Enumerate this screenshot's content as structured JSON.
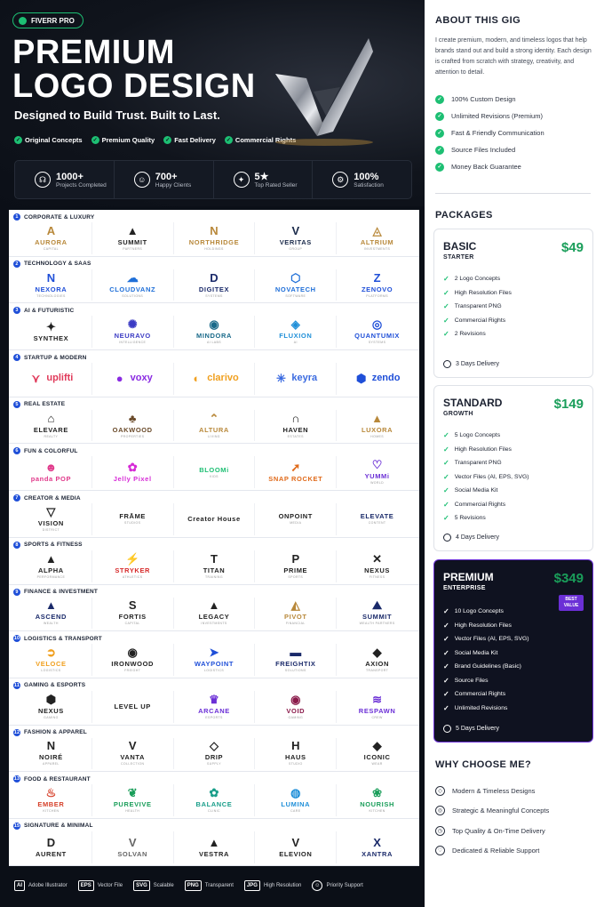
{
  "brand_colors": {
    "green": "#1dbf73",
    "purple": "#6b2fd6",
    "blue": "#1f4fd8"
  },
  "hero": {
    "badge": "FIVERR PRO",
    "title_line1": "PREMIUM",
    "title_line2": "LOGO DESIGN",
    "subtitle": "Designed to Build Trust. Built to Last.",
    "chips": [
      "Original Concepts",
      "Premium Quality",
      "Fast Delivery",
      "Commercial Rights"
    ],
    "stats": [
      {
        "icon": "headset-icon",
        "glyph": "☊",
        "value": "1000+",
        "label": "Projects Completed"
      },
      {
        "icon": "users-icon",
        "glyph": "☺",
        "value": "700+",
        "label": "Happy Clients"
      },
      {
        "icon": "medal-icon",
        "glyph": "✦",
        "value": "5★",
        "label": "Top Rated Seller"
      },
      {
        "icon": "gear-icon",
        "glyph": "⚙",
        "value": "100%",
        "label": "Satisfaction"
      }
    ]
  },
  "categories": [
    {
      "num": "1",
      "title": "CORPORATE & LUXURY",
      "logos": [
        {
          "name": "AURORA",
          "tag": "CAPITAL",
          "mark": "A",
          "color": "#b8883a"
        },
        {
          "name": "SUMMIT",
          "tag": "PARTNERS",
          "mark": "▲",
          "color": "#222"
        },
        {
          "name": "NORTHRIDGE",
          "tag": "HOLDINGS",
          "mark": "N",
          "color": "#b8883a"
        },
        {
          "name": "VERITAS",
          "tag": "GROUP",
          "mark": "V",
          "color": "#1a2a4a"
        },
        {
          "name": "ALTRIUM",
          "tag": "INVESTMENTS",
          "mark": "◬",
          "color": "#b8883a"
        }
      ]
    },
    {
      "num": "2",
      "title": "TECHNOLOGY & SAAS",
      "logos": [
        {
          "name": "NEXORA",
          "tag": "TECHNOLOGIES",
          "mark": "N",
          "color": "#1f4fd8"
        },
        {
          "name": "CLOUDVANZ",
          "tag": "SOLUTIONS",
          "mark": "☁",
          "color": "#1f6fd8"
        },
        {
          "name": "DIGITEX",
          "tag": "SYSTEMS",
          "mark": "D",
          "color": "#1a2a6a"
        },
        {
          "name": "NOVATECH",
          "tag": "SOFTWARE",
          "mark": "⬡",
          "color": "#1f6fd8"
        },
        {
          "name": "ZENOVO",
          "tag": "PLATFORMS",
          "mark": "Z",
          "color": "#1f4fd8"
        }
      ]
    },
    {
      "num": "3",
      "title": "AI & FUTURISTIC",
      "logos": [
        {
          "name": "SYNTHEX",
          "tag": "",
          "mark": "✦",
          "color": "#222"
        },
        {
          "name": "NEURAVO",
          "tag": "INTELLIGENCE",
          "mark": "✺",
          "color": "#3b3bc4"
        },
        {
          "name": "MINDORA",
          "tag": "AI LABS",
          "mark": "◉",
          "color": "#1a6a8a"
        },
        {
          "name": "FLUXION",
          "tag": "AI",
          "mark": "◈",
          "color": "#1f8fd8"
        },
        {
          "name": "QUANTUMIX",
          "tag": "SYSTEMS",
          "mark": "◎",
          "color": "#1f4fd8"
        }
      ]
    },
    {
      "num": "4",
      "title": "STARTUP & MODERN",
      "inline": true,
      "logos": [
        {
          "name": "uplifti",
          "tag": "",
          "mark": "⋎",
          "color": "#e03a5a"
        },
        {
          "name": "voxy",
          "tag": "",
          "mark": "●",
          "color": "#8a2be2"
        },
        {
          "name": "clarivo",
          "tag": "",
          "mark": "◐",
          "color": "#f0a020"
        },
        {
          "name": "keyra",
          "tag": "",
          "mark": "✳",
          "color": "#3b6be0"
        },
        {
          "name": "zendo",
          "tag": "",
          "mark": "⬢",
          "color": "#1f4fd8"
        }
      ]
    },
    {
      "num": "5",
      "title": "REAL ESTATE",
      "logos": [
        {
          "name": "ELEVARE",
          "tag": "REALTY",
          "mark": "⌂",
          "color": "#222"
        },
        {
          "name": "OAKWOOD",
          "tag": "PROPERTIES",
          "mark": "♣",
          "color": "#6a4a2a"
        },
        {
          "name": "ALTURA",
          "tag": "LIVING",
          "mark": "⌃",
          "color": "#b8883a"
        },
        {
          "name": "HAVEN",
          "tag": "ESTATES",
          "mark": "∩",
          "color": "#222"
        },
        {
          "name": "LUXORA",
          "tag": "HOMES",
          "mark": "▲",
          "color": "#b8883a"
        }
      ]
    },
    {
      "num": "6",
      "title": "FUN & COLORFUL",
      "logos": [
        {
          "name": "panda POP",
          "tag": "",
          "mark": "☻",
          "color": "#e0388a"
        },
        {
          "name": "Jelly Pixel",
          "tag": "",
          "mark": "✿",
          "color": "#d62ad6"
        },
        {
          "name": "BLOOMi",
          "tag": "KIDS",
          "mark": "",
          "color": "#1dbf73"
        },
        {
          "name": "SNAP ROCKET",
          "tag": "",
          "mark": "➚",
          "color": "#e06a1a"
        },
        {
          "name": "YUMMi",
          "tag": "WORLD",
          "mark": "♡",
          "color": "#6b2fd6"
        }
      ]
    },
    {
      "num": "7",
      "title": "CREATOR & MEDIA",
      "logos": [
        {
          "name": "VISION",
          "tag": "DISTRICT",
          "mark": "▽",
          "color": "#222"
        },
        {
          "name": "FRĀME",
          "tag": "STUDIOS",
          "mark": "",
          "color": "#222"
        },
        {
          "name": "Creator House",
          "tag": "",
          "mark": "",
          "color": "#222"
        },
        {
          "name": "ONPOINT",
          "tag": "MEDIA",
          "mark": "",
          "color": "#222"
        },
        {
          "name": "ELEVATE",
          "tag": "CONTENT",
          "mark": "",
          "color": "#1a2a6a"
        }
      ]
    },
    {
      "num": "8",
      "title": "SPORTS & FITNESS",
      "logos": [
        {
          "name": "ALPHA",
          "tag": "PERFORMANCE",
          "mark": "▲",
          "color": "#222"
        },
        {
          "name": "STRYKER",
          "tag": "ATHLETICS",
          "mark": "⚡",
          "color": "#d62a2a"
        },
        {
          "name": "TITAN",
          "tag": "TRAINING",
          "mark": "T",
          "color": "#222"
        },
        {
          "name": "PRIME",
          "tag": "SPORTS",
          "mark": "P",
          "color": "#222"
        },
        {
          "name": "NEXUS",
          "tag": "FITNESS",
          "mark": "✕",
          "color": "#222"
        }
      ]
    },
    {
      "num": "9",
      "title": "FINANCE & INVESTMENT",
      "logos": [
        {
          "name": "ASCEND",
          "tag": "WEALTH",
          "mark": "▲",
          "color": "#1a2a6a"
        },
        {
          "name": "FORTIS",
          "tag": "CAPITAL",
          "mark": "S",
          "color": "#222"
        },
        {
          "name": "LEGACY",
          "tag": "INVESTMENTS",
          "mark": "▲",
          "color": "#222"
        },
        {
          "name": "PIVOT",
          "tag": "FINANCIAL",
          "mark": "◭",
          "color": "#b8883a"
        },
        {
          "name": "SUMMIT",
          "tag": "WEALTH PARTNERS",
          "mark": "⛰",
          "color": "#1a2a6a"
        }
      ]
    },
    {
      "num": "10",
      "title": "LOGISTICS & TRANSPORT",
      "logos": [
        {
          "name": "VELOCE",
          "tag": "LOGISTICS",
          "mark": "➲",
          "color": "#f0a020"
        },
        {
          "name": "IRONWOOD",
          "tag": "FREIGHT",
          "mark": "◉",
          "color": "#222"
        },
        {
          "name": "WAYPOINT",
          "tag": "LOGISTICS",
          "mark": "➤",
          "color": "#1f4fd8"
        },
        {
          "name": "FREIGHTIX",
          "tag": "SOLUTIONS",
          "mark": "▬",
          "color": "#1a2a6a"
        },
        {
          "name": "AXION",
          "tag": "TRANSPORT",
          "mark": "◆",
          "color": "#222"
        }
      ]
    },
    {
      "num": "11",
      "title": "GAMING & ESPORTS",
      "logos": [
        {
          "name": "NEXUS",
          "tag": "GAMING",
          "mark": "⬢",
          "color": "#222"
        },
        {
          "name": "LEVEL UP",
          "tag": "",
          "mark": "",
          "color": "#222"
        },
        {
          "name": "ARCANE",
          "tag": "ESPORTS",
          "mark": "♛",
          "color": "#6b2fd6"
        },
        {
          "name": "VOID",
          "tag": "GAMING",
          "mark": "◉",
          "color": "#8a1a4a"
        },
        {
          "name": "RESPAWN",
          "tag": "CREW",
          "mark": "≋",
          "color": "#6b2fd6"
        }
      ]
    },
    {
      "num": "12",
      "title": "FASHION & APPAREL",
      "logos": [
        {
          "name": "NOIRÉ",
          "tag": "APPAREL",
          "mark": "N",
          "color": "#222"
        },
        {
          "name": "VANTA",
          "tag": "COLLECTION",
          "mark": "V",
          "color": "#222"
        },
        {
          "name": "DRIP",
          "tag": "SUPPLY",
          "mark": "◇",
          "color": "#222"
        },
        {
          "name": "HAUS",
          "tag": "STUDIO",
          "mark": "H",
          "color": "#222"
        },
        {
          "name": "ICONIC",
          "tag": "WEAR",
          "mark": "◆",
          "color": "#222"
        }
      ]
    },
    {
      "num": "13",
      "title": "FOOD & RESTAURANT",
      "logos": [
        {
          "name": "EMBER",
          "tag": "KITCHEN",
          "mark": "♨",
          "color": "#d6402a"
        },
        {
          "name": "PUREVIVE",
          "tag": "HEALTH",
          "mark": "❦",
          "color": "#1a9e5a"
        },
        {
          "name": "BALANCE",
          "tag": "CLINIC",
          "mark": "✿",
          "color": "#1a9e8a"
        },
        {
          "name": "LUMINA",
          "tag": "CARE",
          "mark": "◍",
          "color": "#1f8fd8"
        },
        {
          "name": "NOURISH",
          "tag": "KITCHEN",
          "mark": "❀",
          "color": "#1a9e5a"
        }
      ]
    },
    {
      "num": "15",
      "title": "SIGNATURE & MINIMAL",
      "logos": [
        {
          "name": "AURENT",
          "tag": "",
          "mark": "D",
          "color": "#222"
        },
        {
          "name": "SOLVAN",
          "tag": "",
          "mark": "V",
          "color": "#666"
        },
        {
          "name": "VESTRA",
          "tag": "",
          "mark": "▲",
          "color": "#222"
        },
        {
          "name": "ELEVION",
          "tag": "",
          "mark": "V",
          "color": "#222"
        },
        {
          "name": "XANTRA",
          "tag": "",
          "mark": "X",
          "color": "#1a2a6a"
        }
      ]
    }
  ],
  "footer": [
    {
      "badge": "AI",
      "label": "Adobe Illustrator"
    },
    {
      "badge": "EPS",
      "label": "Vector File"
    },
    {
      "badge": "SVG",
      "label": "Scalable"
    },
    {
      "badge": "PNG",
      "label": "Transparent"
    },
    {
      "badge": "JPG",
      "label": "High Resolution"
    },
    {
      "badge": "",
      "label": "Priority Support"
    }
  ],
  "about": {
    "heading": "ABOUT THIS GIG",
    "text": "I create premium, modern, and timeless logos that help brands stand out and build a strong identity. Each design is crafted from scratch with strategy, creativity, and attention to detail.",
    "items": [
      "100% Custom Design",
      "Unlimited Revisions (Premium)",
      "Fast & Friendly Communication",
      "Source Files Included",
      "Money Back Guarantee"
    ]
  },
  "packages": {
    "heading": "PACKAGES",
    "list": [
      {
        "name": "BASIC",
        "sub": "STARTER",
        "price": "$49",
        "features": [
          "2 Logo Concepts",
          "High Resolution Files",
          "Transparent PNG",
          "Commercial Rights",
          "2 Revisions"
        ],
        "delivery": "3 Days Delivery"
      },
      {
        "name": "STANDARD",
        "sub": "GROWTH",
        "price": "$149",
        "features": [
          "5 Logo Concepts",
          "High Resolution Files",
          "Transparent PNG",
          "Vector Files (AI, EPS, SVG)",
          "Social Media Kit",
          "Commercial Rights",
          "5 Revisions"
        ],
        "delivery": "4 Days Delivery"
      },
      {
        "name": "PREMIUM",
        "sub": "ENTERPRISE",
        "price": "$349",
        "badge": "BEST VALUE",
        "features": [
          "10 Logo Concepts",
          "High Resolution Files",
          "Vector Files (AI, EPS, SVG)",
          "Social Media Kit",
          "Brand Guidelines (Basic)",
          "Source Files",
          "Commercial Rights",
          "Unlimited Revisions"
        ],
        "delivery": "5 Days Delivery"
      }
    ]
  },
  "why": {
    "heading": "WHY CHOOSE ME?",
    "items": [
      {
        "icon": "diamond-icon",
        "glyph": "◇",
        "label": "Modern & Timeless Designs"
      },
      {
        "icon": "target-icon",
        "glyph": "◎",
        "label": "Strategic & Meaningful Concepts"
      },
      {
        "icon": "clock-icon",
        "glyph": "◷",
        "label": "Top Quality & On-Time Delivery"
      },
      {
        "icon": "heart-icon",
        "glyph": "♡",
        "label": "Dedicated & Reliable Support"
      }
    ]
  }
}
